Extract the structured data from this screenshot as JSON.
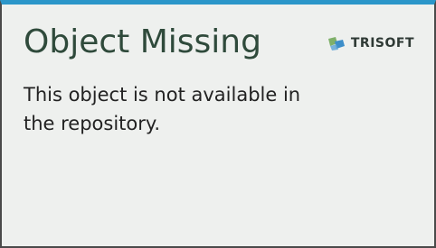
{
  "card": {
    "title": "Object Missing",
    "message": "This object is not available in the repository."
  },
  "logo": {
    "text": "TRISOFT",
    "icon": "trisoft-logo-icon"
  },
  "colors": {
    "accent_bar": "#2b96c9",
    "background": "#eef0ee",
    "border": "#4a4a4a",
    "title": "#2f4a3b"
  }
}
